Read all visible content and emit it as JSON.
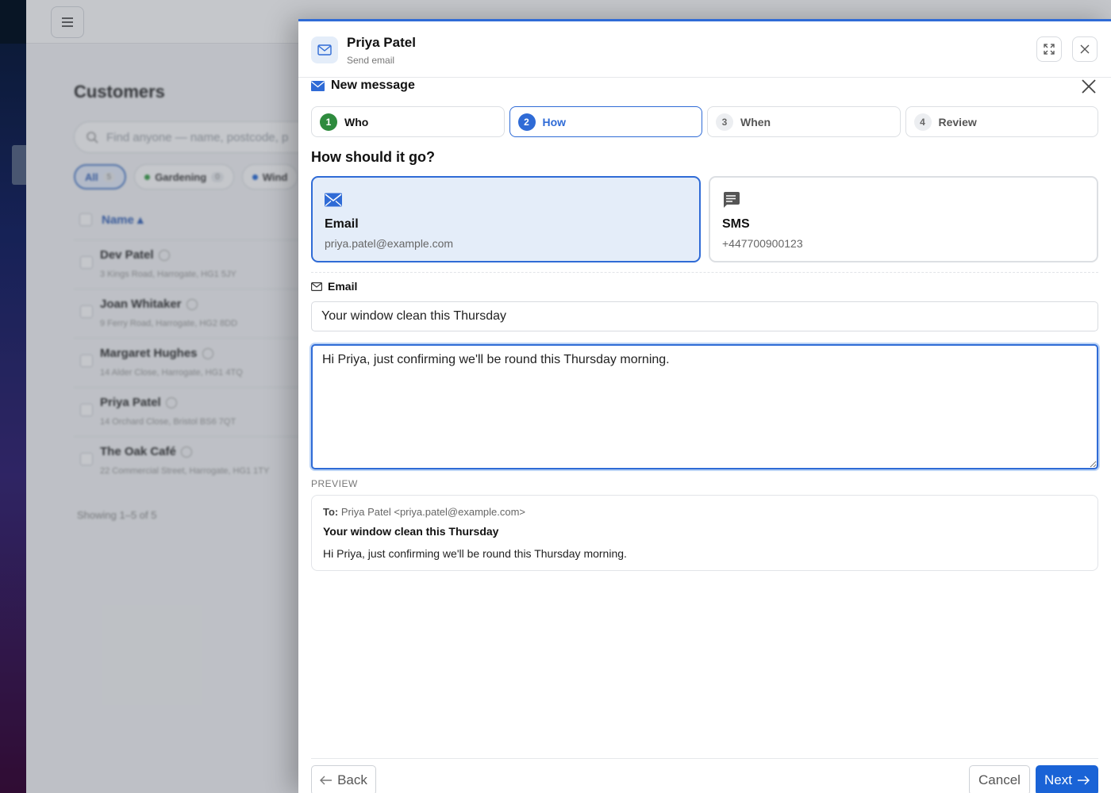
{
  "background": {
    "page_title": "Customers",
    "search_placeholder": "Find anyone — name, postcode, p",
    "filters": [
      {
        "label": "All",
        "count": "5",
        "active": true
      },
      {
        "label": "Gardening",
        "count": "0",
        "color": "#2e9b3e"
      },
      {
        "label": "Wind",
        "color": "#1a63d6"
      }
    ],
    "table_header": "Name ▴",
    "customers": [
      {
        "name": "Dev Patel",
        "address": "3 Kings Road, Harrogate, HG1 5JY"
      },
      {
        "name": "Joan Whitaker",
        "address": "9 Ferry Road, Harrogate, HG2 8DD"
      },
      {
        "name": "Margaret Hughes",
        "address": "14 Alder Close, Harrogate, HG1 4TQ"
      },
      {
        "name": "Priya Patel",
        "address": "14 Orchard Close, Bristol BS6 7QT"
      },
      {
        "name": "The Oak Café",
        "address": "22 Commercial Street, Harrogate, HG1 1TY"
      }
    ],
    "footer": "Showing 1–5 of 5"
  },
  "panel": {
    "contact_name": "Priya Patel",
    "subtitle": "Send email",
    "message_title": "New message",
    "steps": [
      {
        "num": "1",
        "label": "Who",
        "state": "done"
      },
      {
        "num": "2",
        "label": "How",
        "state": "active"
      },
      {
        "num": "3",
        "label": "When",
        "state": "todo"
      },
      {
        "num": "4",
        "label": "Review",
        "state": "todo"
      }
    ],
    "question": "How should it go?",
    "channels": {
      "email": {
        "label": "Email",
        "value": "priya.patel@example.com",
        "selected": true
      },
      "sms": {
        "label": "SMS",
        "value": "+447700900123",
        "selected": false
      }
    },
    "field_label": "Email",
    "subject": "Your window clean this Thursday",
    "body": "Hi Priya, just confirming we'll be round this Thursday morning.",
    "preview": {
      "heading": "PREVIEW",
      "to_label": "To:",
      "to_value": "Priya Patel <priya.patel@example.com>",
      "subject": "Your window clean this Thursday",
      "body": "Hi Priya, just confirming we'll be round this Thursday morning."
    },
    "buttons": {
      "back": "Back",
      "cancel": "Cancel",
      "next": "Next"
    }
  },
  "colors": {
    "accent": "#2f6bd6",
    "primary_button": "#1a63d6",
    "done_step": "#2e8b3e",
    "selected_card_bg": "#e4edf9"
  }
}
